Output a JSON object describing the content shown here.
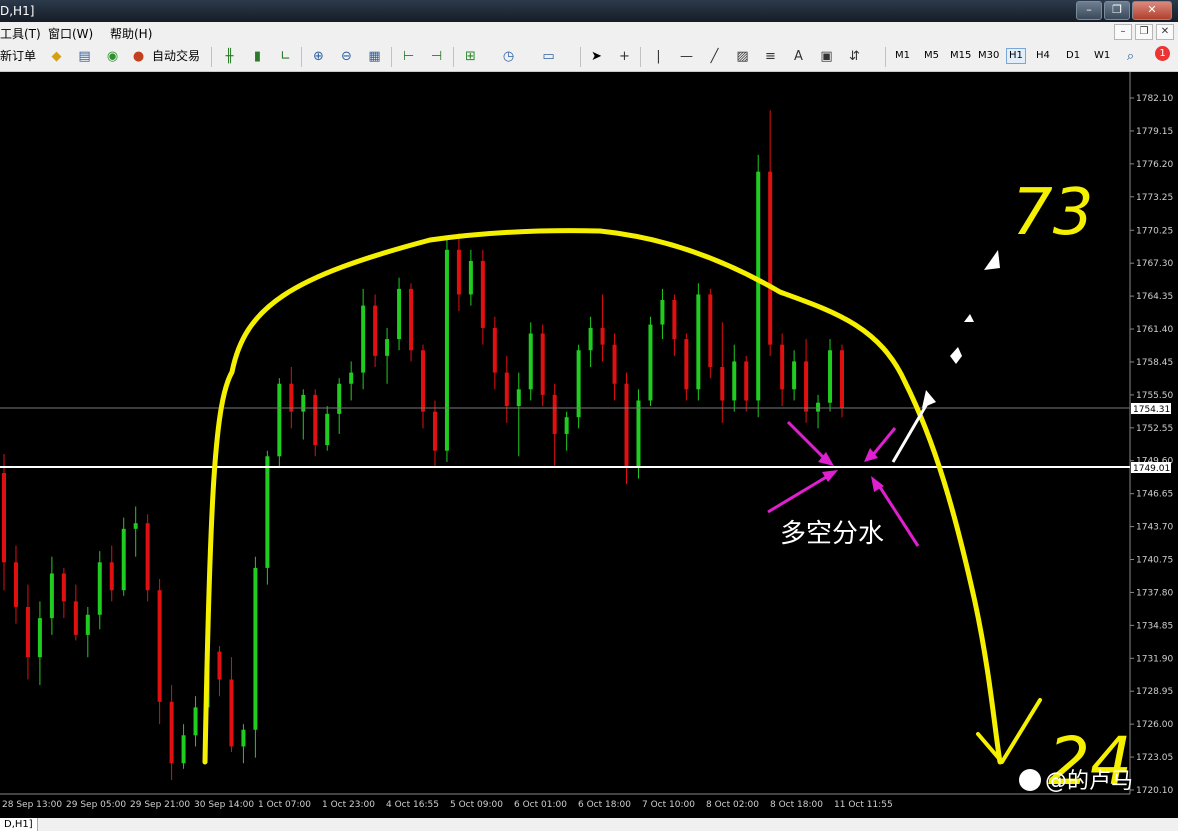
{
  "window": {
    "title": "D,H1]"
  },
  "menu": {
    "items": [
      "工具(T)",
      "窗口(W)",
      "帮助(H)"
    ]
  },
  "toolbar": {
    "new_order": "新订单",
    "auto_trade": "自动交易",
    "timeframes": [
      "M1",
      "M5",
      "M15",
      "M30",
      "H1",
      "H4",
      "D1",
      "W1"
    ],
    "active_timeframe": "H1",
    "notification_count": "1",
    "line_tool_label": "A"
  },
  "chart": {
    "price_ticks": [
      "1782.10",
      "1779.15",
      "1776.20",
      "1773.25",
      "1770.25",
      "1767.30",
      "1764.35",
      "1761.40",
      "1758.45",
      "1755.50",
      "1752.55",
      "1749.60",
      "1746.65",
      "1743.70",
      "1740.75",
      "1737.80",
      "1734.85",
      "1731.90",
      "1728.95",
      "1726.00",
      "1723.05",
      "1720.10"
    ],
    "time_ticks": [
      "28 Sep 13:00",
      "29 Sep 05:00",
      "29 Sep 21:00",
      "30 Sep 14:00",
      "1 Oct 07:00",
      "1 Oct 23:00",
      "4 Oct 16:55",
      "5 Oct 09:00",
      "6 Oct 01:00",
      "6 Oct 18:00",
      "7 Oct 10:00",
      "8 Oct 02:00",
      "8 Oct 18:00",
      "11 Oct 11:55"
    ],
    "current_price_label": "1754.31",
    "level_label": "1749.01",
    "annotation_text": "多空分水",
    "target_up": "73",
    "target_down": "24",
    "watermark": "@的卢马",
    "bull_color": "#1fcc1f",
    "bear_color": "#e01010",
    "drawing_color": "#f5f000"
  },
  "chart_data": {
    "type": "candlestick",
    "series_up_color": "#1fcc1f",
    "series_down_color": "#e01010",
    "ohlc": [
      [
        1748.5,
        1750.2,
        1738.0,
        1740.5
      ],
      [
        1740.5,
        1742.0,
        1735.0,
        1736.5
      ],
      [
        1736.5,
        1738.5,
        1730.0,
        1732.0
      ],
      [
        1732.0,
        1737.0,
        1729.5,
        1735.5
      ],
      [
        1735.5,
        1741.0,
        1734.0,
        1739.5
      ],
      [
        1739.5,
        1740.0,
        1735.5,
        1737.0
      ],
      [
        1737.0,
        1738.5,
        1733.5,
        1734.0
      ],
      [
        1734.0,
        1736.5,
        1732.0,
        1735.8
      ],
      [
        1735.8,
        1741.5,
        1734.5,
        1740.5
      ],
      [
        1740.5,
        1742.0,
        1737.0,
        1738.0
      ],
      [
        1738.0,
        1744.5,
        1737.5,
        1743.5
      ],
      [
        1743.5,
        1745.5,
        1741.0,
        1744.0
      ],
      [
        1744.0,
        1744.8,
        1737.0,
        1738.0
      ],
      [
        1738.0,
        1739.0,
        1726.0,
        1728.0
      ],
      [
        1728.0,
        1729.5,
        1721.0,
        1722.5
      ],
      [
        1722.5,
        1726.0,
        1722.0,
        1725.0
      ],
      [
        1725.0,
        1728.5,
        1724.0,
        1727.5
      ],
      [
        1727.5,
        1733.5,
        1727.0,
        1732.5
      ],
      [
        1732.5,
        1733.0,
        1728.5,
        1730.0
      ],
      [
        1730.0,
        1732.0,
        1723.5,
        1724.0
      ],
      [
        1724.0,
        1726.0,
        1722.5,
        1725.5
      ],
      [
        1725.5,
        1741.0,
        1723.0,
        1740.0
      ],
      [
        1740.0,
        1750.5,
        1738.5,
        1750.0
      ],
      [
        1750.0,
        1757.0,
        1749.0,
        1756.5
      ],
      [
        1756.5,
        1758.0,
        1752.5,
        1754.0
      ],
      [
        1754.0,
        1756.0,
        1751.5,
        1755.5
      ],
      [
        1755.5,
        1756.0,
        1750.0,
        1751.0
      ],
      [
        1751.0,
        1754.5,
        1750.5,
        1753.8
      ],
      [
        1753.8,
        1757.0,
        1752.0,
        1756.5
      ],
      [
        1756.5,
        1758.5,
        1755.0,
        1757.5
      ],
      [
        1757.5,
        1765.0,
        1756.0,
        1763.5
      ],
      [
        1763.5,
        1764.5,
        1758.0,
        1759.0
      ],
      [
        1759.0,
        1761.5,
        1756.5,
        1760.5
      ],
      [
        1760.5,
        1766.0,
        1759.5,
        1765.0
      ],
      [
        1765.0,
        1765.5,
        1758.5,
        1759.5
      ],
      [
        1759.5,
        1760.0,
        1752.5,
        1754.0
      ],
      [
        1754.0,
        1755.0,
        1749.0,
        1750.5
      ],
      [
        1750.5,
        1769.5,
        1749.5,
        1768.5
      ],
      [
        1768.5,
        1770.0,
        1763.0,
        1764.5
      ],
      [
        1764.5,
        1768.5,
        1763.5,
        1767.5
      ],
      [
        1767.5,
        1768.5,
        1760.0,
        1761.5
      ],
      [
        1761.5,
        1762.5,
        1756.0,
        1757.5
      ],
      [
        1757.5,
        1759.0,
        1753.0,
        1754.5
      ],
      [
        1754.5,
        1757.5,
        1750.0,
        1756.0
      ],
      [
        1756.0,
        1762.0,
        1755.0,
        1761.0
      ],
      [
        1761.0,
        1761.8,
        1754.5,
        1755.5
      ],
      [
        1755.5,
        1756.5,
        1749.0,
        1752.0
      ],
      [
        1752.0,
        1754.0,
        1750.5,
        1753.5
      ],
      [
        1753.5,
        1760.0,
        1752.5,
        1759.5
      ],
      [
        1759.5,
        1762.5,
        1758.0,
        1761.5
      ],
      [
        1761.5,
        1764.5,
        1758.5,
        1760.0
      ],
      [
        1760.0,
        1761.0,
        1755.0,
        1756.5
      ],
      [
        1756.5,
        1757.5,
        1747.5,
        1749.0
      ],
      [
        1749.0,
        1756.0,
        1748.0,
        1755.0
      ],
      [
        1755.0,
        1762.5,
        1754.5,
        1761.8
      ],
      [
        1761.8,
        1765.0,
        1760.5,
        1764.0
      ],
      [
        1764.0,
        1764.5,
        1759.0,
        1760.5
      ],
      [
        1760.5,
        1761.0,
        1755.0,
        1756.0
      ],
      [
        1756.0,
        1765.5,
        1755.0,
        1764.5
      ],
      [
        1764.5,
        1765.0,
        1757.0,
        1758.0
      ],
      [
        1758.0,
        1762.0,
        1753.0,
        1755.0
      ],
      [
        1755.0,
        1760.0,
        1754.0,
        1758.5
      ],
      [
        1758.5,
        1759.0,
        1754.0,
        1755.0
      ],
      [
        1755.0,
        1777.0,
        1753.5,
        1775.5
      ],
      [
        1775.5,
        1781.0,
        1759.0,
        1760.0
      ],
      [
        1760.0,
        1761.0,
        1754.5,
        1756.0
      ],
      [
        1756.0,
        1759.5,
        1755.0,
        1758.5
      ],
      [
        1758.5,
        1760.5,
        1753.0,
        1754.0
      ],
      [
        1754.0,
        1755.5,
        1752.5,
        1754.8
      ],
      [
        1754.8,
        1760.5,
        1754.0,
        1759.5
      ],
      [
        1759.5,
        1760.0,
        1753.5,
        1754.3
      ]
    ]
  }
}
